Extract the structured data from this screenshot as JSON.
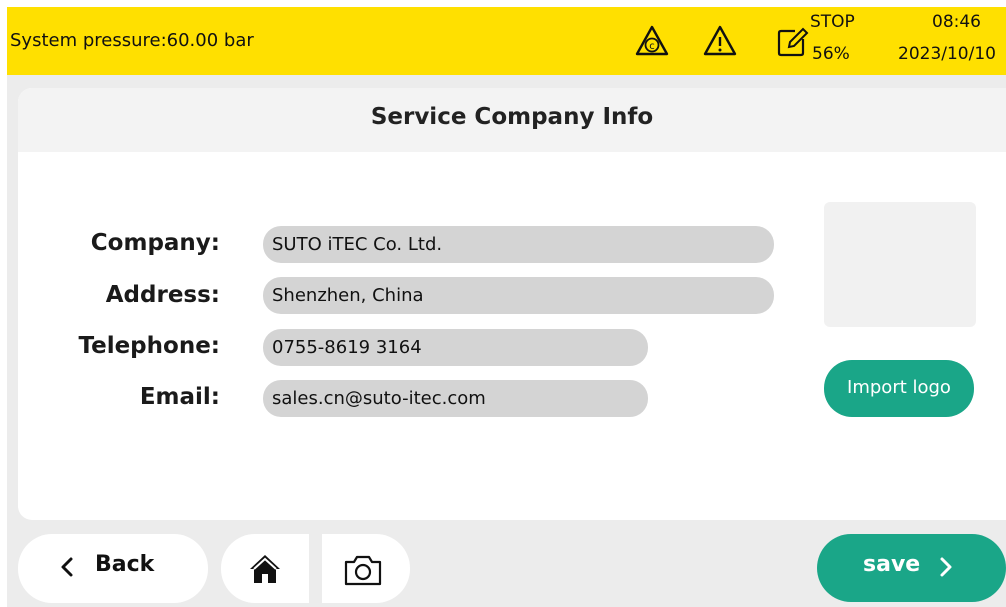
{
  "status_bar": {
    "pressure": "System pressure:60.00 bar",
    "stop_label": "STOP",
    "stop_percent": "56%",
    "time": "08:46",
    "date": "2023/10/10",
    "icons": [
      "calibration-warning-icon",
      "warning-icon",
      "edit-note-icon"
    ]
  },
  "page": {
    "title": "Service Company Info"
  },
  "form": {
    "company_label": "Company:",
    "company_value": "SUTO iTEC Co. Ltd.",
    "address_label": "Address:",
    "address_value": "Shenzhen, China",
    "telephone_label": "Telephone:",
    "telephone_value": "0755-8619 3164",
    "email_label": "Email:",
    "email_value": "sales.cn@suto-itec.com"
  },
  "logo": {
    "import_label": "Import logo"
  },
  "footer": {
    "back_label": "Back",
    "back_icon": "chevron-left-icon",
    "home_icon": "home-icon",
    "camera_icon": "camera-icon",
    "save_label": "save",
    "save_icon": "chevron-right-icon"
  },
  "colors": {
    "status_bar": "#ffe000",
    "accent": "#1aa688",
    "field_bg": "#d4d4d4",
    "frame_bg": "#ececec"
  }
}
